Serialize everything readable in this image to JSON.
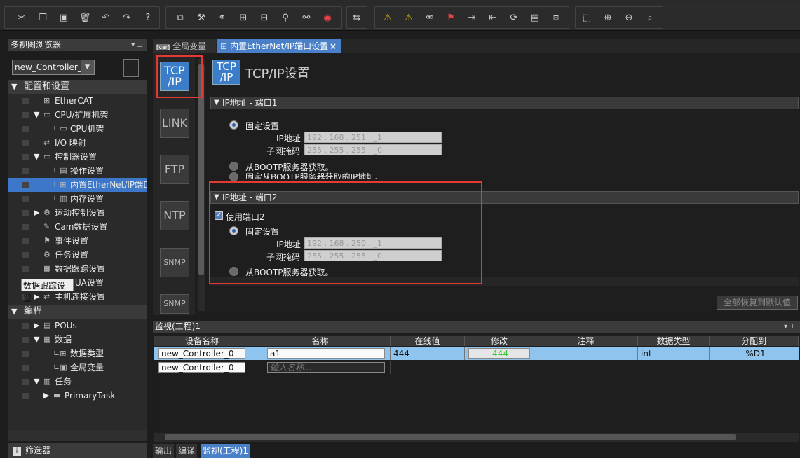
{
  "left_pane": {
    "title": "多视图浏览器",
    "controller_select": "new_Controller_0",
    "tree": [
      {
        "label": "配置和设置",
        "type": "header"
      },
      {
        "label": "EtherCAT"
      },
      {
        "label": "CPU/扩展机架"
      },
      {
        "label": "CPU机架"
      },
      {
        "label": "I/O 映射"
      },
      {
        "label": "控制器设置"
      },
      {
        "label": "操作设置"
      },
      {
        "label": "内置EtherNet/IP端口设置",
        "selected": true
      },
      {
        "label": "内存设置"
      },
      {
        "label": "运动控制设置"
      },
      {
        "label": "Cam数据设置"
      },
      {
        "label": "事件设置"
      },
      {
        "label": "任务设置"
      },
      {
        "label": "数据跟踪设置"
      },
      {
        "label": "OPC UA设置"
      },
      {
        "label": "主机连接设置"
      },
      {
        "label": "编程",
        "type": "header"
      },
      {
        "label": "POUs"
      },
      {
        "label": "数据"
      },
      {
        "label": "数据类型"
      },
      {
        "label": "全局变量"
      },
      {
        "label": "任务"
      },
      {
        "label": "PrimaryTask"
      }
    ],
    "tooltip": "数据跟踪设置",
    "filter_label": "筛选器"
  },
  "tabs": [
    {
      "label": "全局变量",
      "badge": "[var]"
    },
    {
      "label": "内置EtherNet/IP端口设置",
      "active": true
    }
  ],
  "nav": [
    {
      "label": "TCP/IP",
      "active": true
    },
    {
      "label": "LINK"
    },
    {
      "label": "FTP"
    },
    {
      "label": "NTP"
    },
    {
      "label": "SNMP"
    },
    {
      "label": "SNMP"
    }
  ],
  "panel": {
    "icon_text": "TCP/IP",
    "title": "TCP/IP设置",
    "port1": {
      "header": "IP地址 - 端口1",
      "fixed": "固定设置",
      "ip_label": "IP地址",
      "ip": "192 . 168 . 251 . _1",
      "mask_label": "子网掩码",
      "mask": "255 . 255 . 255 . _0",
      "bootp": "从BOOTP服务器获取。",
      "fixed_bootp": "固定从BOOTP服务器获取的IP地址。"
    },
    "port2": {
      "header": "IP地址 - 端口2",
      "use_port": "使用端口2",
      "fixed": "固定设置",
      "ip_label": "IP地址",
      "ip": "192 . 168 . 250 . _1",
      "mask_label": "子网掩码",
      "mask": "255 . 255 . 255 . _0",
      "bootp": "从BOOTP服务器获取。"
    },
    "reset_button": "全部恢复到默认值"
  },
  "monitor": {
    "title": "监视(工程)1",
    "columns": [
      "设备名称",
      "名称",
      "在线值",
      "修改",
      "注释",
      "数据类型",
      "分配到"
    ],
    "rows": [
      {
        "device": "new_Controller_0",
        "name": "a1",
        "online": "444",
        "modify": "444",
        "comment": "",
        "type": "int",
        "assign": "%D1"
      },
      {
        "device": "new_Controller_0",
        "name_placeholder": "输入名称..."
      }
    ]
  },
  "bottom_tabs": [
    "输出",
    "编译",
    "监视(工程)1"
  ],
  "colors": {
    "accent": "#3b7dc9",
    "highlight_box": "#e53935",
    "online_value": "#37c837"
  }
}
